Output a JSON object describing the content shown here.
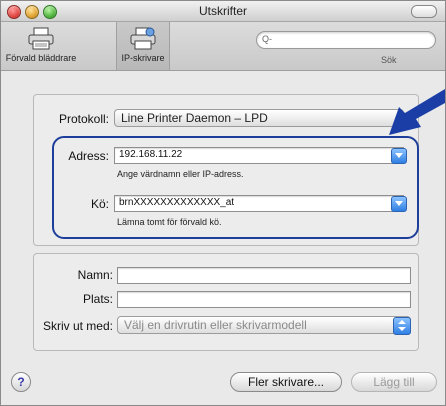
{
  "window": {
    "title": "Utskrifter"
  },
  "toolbar": {
    "tabs": [
      {
        "label": "Förvald bläddrare"
      },
      {
        "label": "IP-skrivare"
      }
    ],
    "search": {
      "placeholder": "Q-",
      "label": "Sök"
    }
  },
  "form": {
    "protocol": {
      "label": "Protokoll:",
      "value": "Line Printer Daemon – LPD"
    },
    "address": {
      "label": "Adress:",
      "value": "192.168.11.22",
      "hint": "Ange värdnamn eller IP-adress."
    },
    "queue": {
      "label": "Kö:",
      "value": "brnXXXXXXXXXXXXX_at",
      "hint": "Lämna tomt för förvald kö."
    },
    "name": {
      "label": "Namn:",
      "value": ""
    },
    "location": {
      "label": "Plats:",
      "value": ""
    },
    "print_using": {
      "label": "Skriv ut med:",
      "value": "Välj en drivrutin eller skrivarmodell"
    }
  },
  "footer": {
    "help": "?",
    "more_printers": "Fler skrivare...",
    "add": "Lägg till"
  },
  "colors": {
    "accent": "#1d3e9a",
    "arrow": "#1a3ea6"
  },
  "icons": [
    "printer-icon",
    "ip-printer-icon",
    "search-icon",
    "help-icon",
    "arrow-icon"
  ]
}
